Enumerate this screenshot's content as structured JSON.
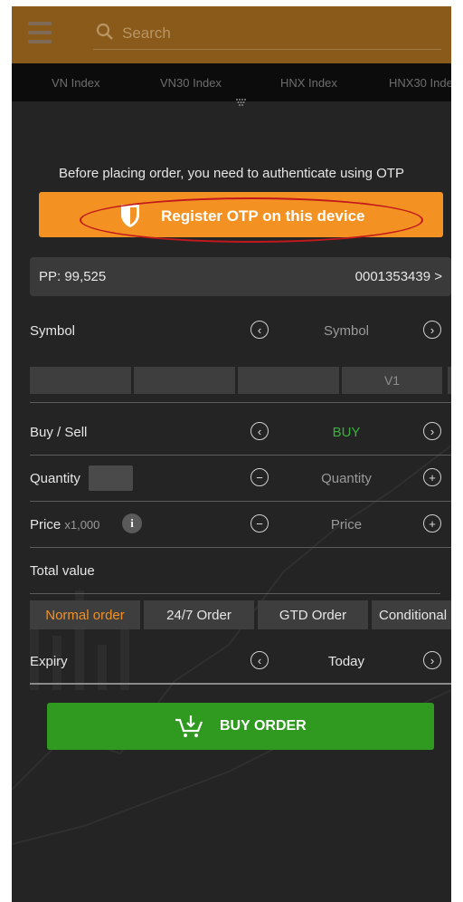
{
  "header": {
    "search_placeholder": "Search"
  },
  "tickers": [
    "VN Index",
    "VN30 Index",
    "HNX Index",
    "HNX30 Inde"
  ],
  "otp": {
    "message": "Before placing order, you need to authenticate using OTP",
    "button_label": "Register OTP on this device"
  },
  "account": {
    "pp": "PP: 99,525",
    "account_no": "0001353439 >"
  },
  "form": {
    "symbol_label": "Symbol",
    "symbol_value": "Symbol",
    "cells": [
      "",
      "",
      "",
      "V1",
      ""
    ],
    "buysell_label": "Buy / Sell",
    "buysell_value": "BUY",
    "quantity_label": "Quantity",
    "quantity_value": "Quantity",
    "price_label": "Price",
    "price_unit": "x1,000",
    "price_value": "Price",
    "total_label": "Total value",
    "order_types": [
      "Normal order",
      "24/7 Order",
      "GTD Order",
      "Conditional"
    ],
    "expiry_label": "Expiry",
    "expiry_value": "Today"
  },
  "buy_button_label": "BUY ORDER",
  "colors": {
    "accent_orange": "#f39122",
    "buy_green": "#2f9a1f",
    "header_brown": "#8a5a1a",
    "highlight_red": "#c0181c",
    "background": "#242424"
  }
}
